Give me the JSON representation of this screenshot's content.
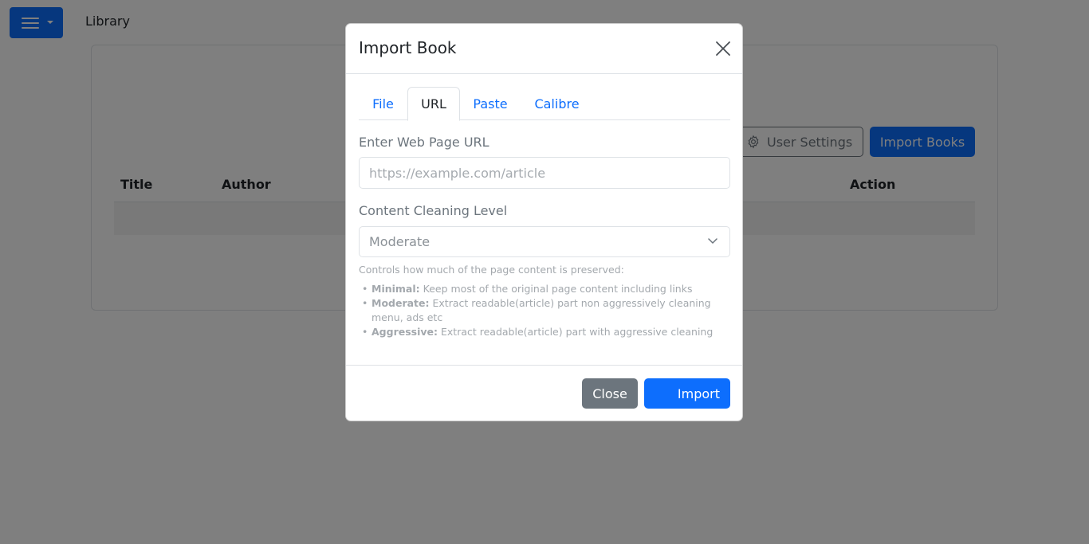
{
  "navbar": {
    "title": "Library"
  },
  "page": {
    "user_settings_label": "User Settings",
    "import_books_label": "Import Books",
    "table_headers": [
      "Title",
      "Author",
      "Action"
    ]
  },
  "modal": {
    "title": "Import Book",
    "tabs": [
      {
        "label": "File",
        "active": false
      },
      {
        "label": "URL",
        "active": true
      },
      {
        "label": "Paste",
        "active": false
      },
      {
        "label": "Calibre",
        "active": false
      }
    ],
    "url_label": "Enter Web Page URL",
    "url_placeholder": "https://example.com/article",
    "url_value": "",
    "cleaning_label": "Content Cleaning Level",
    "cleaning_selected": "Moderate",
    "help_intro": "Controls how much of the page content is preserved:",
    "help_items": [
      {
        "term": "Minimal:",
        "text": "Keep most of the original page content including links"
      },
      {
        "term": "Moderate:",
        "text": "Extract readable(article) part non aggressively cleaning menu, ads etc"
      },
      {
        "term": "Aggressive:",
        "text": "Extract readable(article) part with aggressive cleaning"
      }
    ],
    "close_label": "Close",
    "import_label": "Import"
  },
  "colors": {
    "primary": "#0d6efd",
    "secondary": "#6c757d",
    "backdrop": "rgba(0,0,0,0.5)"
  }
}
